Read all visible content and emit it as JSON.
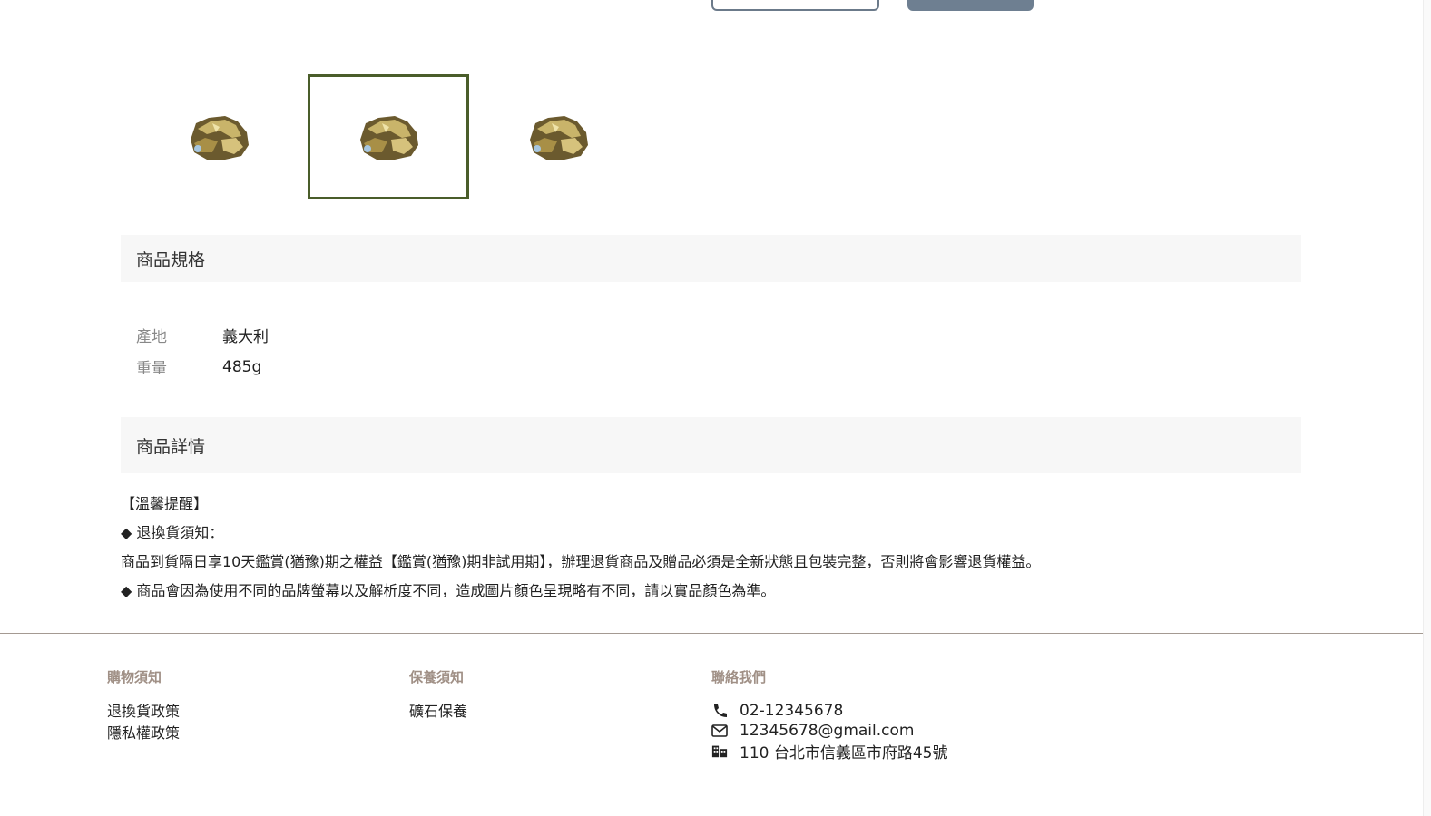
{
  "thumbnails": [
    {
      "name": "mineral-thumb-1",
      "active": false
    },
    {
      "name": "mineral-thumb-2",
      "active": true
    },
    {
      "name": "mineral-thumb-3",
      "active": false
    }
  ],
  "spec": {
    "title": "商品規格",
    "rows": [
      {
        "key": "產地",
        "value": "義大利"
      },
      {
        "key": "重量",
        "value": "485g"
      }
    ]
  },
  "detail": {
    "title": "商品詳情",
    "lines": [
      "【溫馨提醒】",
      "◆ 退換貨須知：",
      "商品到貨隔日享10天鑑賞(猶豫)期之權益【鑑賞(猶豫)期非試用期】，辦理退貨商品及贈品必須是全新狀態且包裝完整，否則將會影響退貨權益。",
      "◆ 商品會因為使用不同的品牌螢幕以及解析度不同，造成圖片顏色呈現略有不同，請以實品顏色為準。"
    ]
  },
  "footer": {
    "shopping": {
      "title": "購物須知",
      "links": [
        "退換貨政策",
        "隱私權政策"
      ]
    },
    "care": {
      "title": "保養須知",
      "links": [
        "礦石保養"
      ]
    },
    "contact": {
      "title": "聯絡我們",
      "phone": "02-12345678",
      "email": "12345678@gmail.com",
      "address": "110 台北市信義區市府路45號"
    }
  },
  "colors": {
    "accent": "#4a5d2a",
    "footer_heading": "#a09086",
    "button": "#6e7f91"
  }
}
